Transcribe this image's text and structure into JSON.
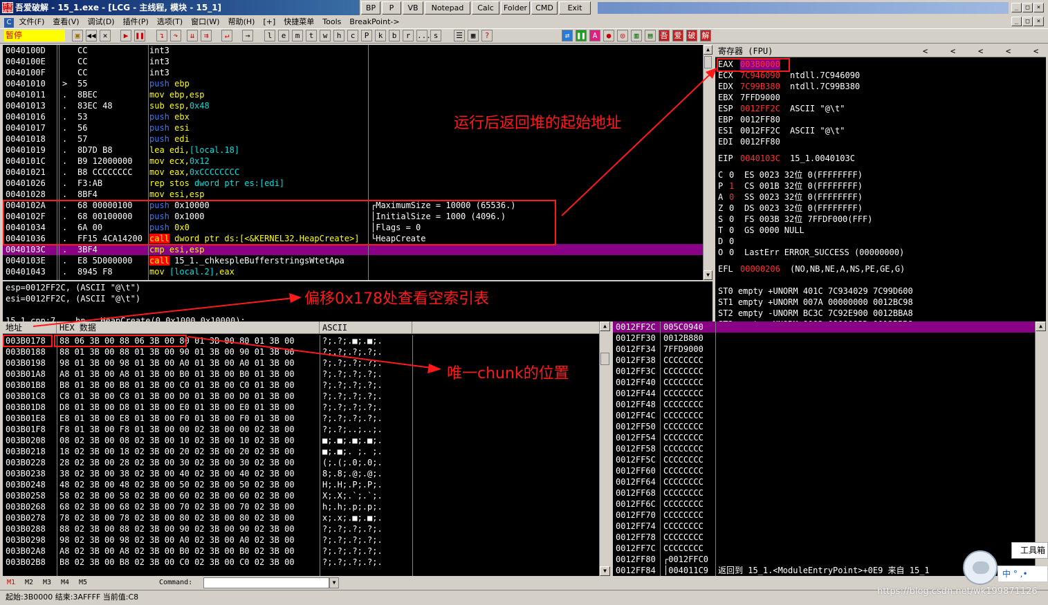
{
  "window": {
    "title": "吾爱破解 - 15_1.exe - [LCG - 主线程, 模块 - 15_1]",
    "logo": "吾爱破解"
  },
  "quick_buttons": [
    "BP",
    "P",
    "VB",
    "Notepad",
    "Calc",
    "Folder",
    "CMD",
    "Exit"
  ],
  "window_buttons": [
    "_",
    "□",
    "×"
  ],
  "child_window_buttons": [
    "_",
    "□",
    "×"
  ],
  "menu": {
    "app_icon": "C",
    "items": [
      "文件(F)",
      "查看(V)",
      "调试(D)",
      "插件(P)",
      "选项(T)",
      "窗口(W)",
      "帮助(H)",
      "[+]",
      "快捷菜单",
      "Tools",
      "BreakPoint->"
    ]
  },
  "toolbar": {
    "status": "暂停",
    "letters": [
      "l",
      "e",
      "m",
      "t",
      "w",
      "h",
      "c",
      "P",
      "k",
      "b",
      "r",
      "...",
      "s"
    ],
    "right_icons": [
      "吾",
      "爱",
      "破",
      "解"
    ]
  },
  "disasm": {
    "rows": [
      {
        "addr": "0040100D",
        "mark": "",
        "hex": "CC",
        "asm": [
          {
            "t": "int3",
            "c": ""
          }
        ],
        "cmt": ""
      },
      {
        "addr": "0040100E",
        "mark": "",
        "hex": "CC",
        "asm": [
          {
            "t": "int3",
            "c": ""
          }
        ],
        "cmt": ""
      },
      {
        "addr": "0040100F",
        "mark": "",
        "hex": "CC",
        "asm": [
          {
            "t": "int3",
            "c": ""
          }
        ],
        "cmt": ""
      },
      {
        "addr": "00401010",
        "mark": ">",
        "hex": "55",
        "asm": [
          {
            "t": "push ",
            "c": "blue"
          },
          {
            "t": "ebp",
            "c": "yel"
          }
        ],
        "cmt": ""
      },
      {
        "addr": "00401011",
        "mark": ".",
        "hex": "8BEC",
        "asm": [
          {
            "t": "mov ",
            "c": "yel"
          },
          {
            "t": "ebp,esp",
            "c": "yel"
          }
        ],
        "cmt": ""
      },
      {
        "addr": "00401013",
        "mark": ".",
        "hex": "83EC 48",
        "asm": [
          {
            "t": "sub ",
            "c": "yel"
          },
          {
            "t": "esp,",
            "c": "yel"
          },
          {
            "t": "0x48",
            "c": "cyan"
          }
        ],
        "cmt": ""
      },
      {
        "addr": "00401016",
        "mark": ".",
        "hex": "53",
        "asm": [
          {
            "t": "push ",
            "c": "blue"
          },
          {
            "t": "ebx",
            "c": "yel"
          }
        ],
        "cmt": ""
      },
      {
        "addr": "00401017",
        "mark": ".",
        "hex": "56",
        "asm": [
          {
            "t": "push ",
            "c": "blue"
          },
          {
            "t": "esi",
            "c": "yel"
          }
        ],
        "cmt": ""
      },
      {
        "addr": "00401018",
        "mark": ".",
        "hex": "57",
        "asm": [
          {
            "t": "push ",
            "c": "blue"
          },
          {
            "t": "edi",
            "c": "yel"
          }
        ],
        "cmt": ""
      },
      {
        "addr": "00401019",
        "mark": ".",
        "hex": "8D7D B8",
        "asm": [
          {
            "t": "lea ",
            "c": "yel"
          },
          {
            "t": "edi,",
            "c": "yel"
          },
          {
            "t": "[local.18]",
            "c": "cyan"
          }
        ],
        "cmt": ""
      },
      {
        "addr": "0040101C",
        "mark": ".",
        "hex": "B9 12000000",
        "asm": [
          {
            "t": "mov ",
            "c": "yel"
          },
          {
            "t": "ecx,",
            "c": "yel"
          },
          {
            "t": "0x12",
            "c": "cyan"
          }
        ],
        "cmt": ""
      },
      {
        "addr": "00401021",
        "mark": ".",
        "hex": "B8 CCCCCCCC",
        "asm": [
          {
            "t": "mov ",
            "c": "yel"
          },
          {
            "t": "eax,",
            "c": "yel"
          },
          {
            "t": "0xCCCCCCCC",
            "c": "cyan"
          }
        ],
        "cmt": ""
      },
      {
        "addr": "00401026",
        "mark": ".",
        "hex": "F3:AB",
        "asm": [
          {
            "t": "rep stos ",
            "c": "yel"
          },
          {
            "t": "dword ptr es:[edi]",
            "c": "cyan"
          }
        ],
        "cmt": ""
      },
      {
        "addr": "00401028",
        "mark": ".",
        "hex": "8BF4",
        "asm": [
          {
            "t": "mov ",
            "c": "yel"
          },
          {
            "t": "esi,esp",
            "c": "yel"
          }
        ],
        "cmt": ""
      },
      {
        "addr": "0040102A",
        "mark": ".",
        "hex": "68 00000100",
        "asm": [
          {
            "t": "push ",
            "c": "blue"
          },
          {
            "t": "0x10000",
            "c": ""
          }
        ],
        "cmt": "┌MaximumSize = 10000 (65536.)"
      },
      {
        "addr": "0040102F",
        "mark": ".",
        "hex": "68 00100000",
        "asm": [
          {
            "t": "push ",
            "c": "blue"
          },
          {
            "t": "0x1000",
            "c": ""
          }
        ],
        "cmt": "│InitialSize = 1000 (4096.)"
      },
      {
        "addr": "00401034",
        "mark": ".",
        "hex": "6A 00",
        "asm": [
          {
            "t": "push ",
            "c": "blue"
          },
          {
            "t": "0x0",
            "c": "yel"
          }
        ],
        "cmt": "│Flags = 0"
      },
      {
        "addr": "00401036",
        "mark": ".",
        "hex": "FF15 4CA14200",
        "asm": [
          {
            "t": "call",
            "c": "call"
          },
          {
            "t": " dword ptr ds:[<&KERNEL32.HeapCreate>]",
            "c": "yel"
          }
        ],
        "cmt": "└HeapCreate"
      },
      {
        "addr": "0040103C",
        "mark": ".",
        "hex": "3BF4",
        "asm": [
          {
            "t": "cmp ",
            "c": "yel"
          },
          {
            "t": "esi,esp",
            "c": "yel"
          }
        ],
        "cmt": "",
        "sel": true
      },
      {
        "addr": "0040103E",
        "mark": ".",
        "hex": "E8 5D000000",
        "asm": [
          {
            "t": "call",
            "c": "call"
          },
          {
            "t": " 15_1._chkesp",
            "c": ""
          },
          {
            "t": "leBufferstringsWtetApa",
            "c": ""
          }
        ],
        "cmt": ""
      },
      {
        "addr": "00401043",
        "mark": ".",
        "hex": "8945 F8",
        "asm": [
          {
            "t": "mov ",
            "c": "yel"
          },
          {
            "t": "[local.2],",
            "c": "cyan"
          },
          {
            "t": "eax",
            "c": "yel"
          }
        ],
        "cmt": ""
      }
    ]
  },
  "info": {
    "line1": "esp=0012FF2C, (ASCII \"@\\t\")",
    "line2": "esi=0012FF2C, (ASCII \"@\\t\")",
    "line3": "15_1.cpp:7    hp = HeapCreate(0,0x1000,0x10000);"
  },
  "dump": {
    "headers": {
      "addr": "地址",
      "hex": "HEX 数据",
      "ascii": "ASCII"
    },
    "rows": [
      {
        "a": "003B0178",
        "h": "88 06 3B 00 88 06 3B 00 80 01 3B 00 80 01 3B 00",
        "s": "?;.?;.■;.■;."
      },
      {
        "a": "003B0188",
        "h": "88 01 3B 00 88 01 3B 00 90 01 3B 00 90 01 3B 00",
        "s": "?;.?;.?;.?;."
      },
      {
        "a": "003B0198",
        "h": "98 01 3B 00 98 01 3B 00 A0 01 3B 00 A0 01 3B 00",
        "s": "?;.?;.?;.?;."
      },
      {
        "a": "003B01A8",
        "h": "A8 01 3B 00 A8 01 3B 00 B0 01 3B 00 B0 01 3B 00",
        "s": "?;.?;.?;.?;."
      },
      {
        "a": "003B01B8",
        "h": "B8 01 3B 00 B8 01 3B 00 C0 01 3B 00 C0 01 3B 00",
        "s": "?;.?;.?;.?;."
      },
      {
        "a": "003B01C8",
        "h": "C8 01 3B 00 C8 01 3B 00 D0 01 3B 00 D0 01 3B 00",
        "s": "?;.?;.?;.?;."
      },
      {
        "a": "003B01D8",
        "h": "D8 01 3B 00 D8 01 3B 00 E0 01 3B 00 E0 01 3B 00",
        "s": "?;.?;.?;.?;."
      },
      {
        "a": "003B01E8",
        "h": "E8 01 3B 00 E8 01 3B 00 F0 01 3B 00 F0 01 3B 00",
        "s": "?;.?;.?;.?;."
      },
      {
        "a": "003B01F8",
        "h": "F8 01 3B 00 F8 01 3B 00 00 02 3B 00 00 02 3B 00",
        "s": "?;.?;..;..;."
      },
      {
        "a": "003B0208",
        "h": "08 02 3B 00 08 02 3B 00 10 02 3B 00 10 02 3B 00",
        "s": "■;.■;.■;.■;."
      },
      {
        "a": "003B0218",
        "h": "18 02 3B 00 18 02 3B 00 20 02 3B 00 20 02 3B 00",
        "s": "■;.■;. ;. ;."
      },
      {
        "a": "003B0228",
        "h": "28 02 3B 00 28 02 3B 00 30 02 3B 00 30 02 3B 00",
        "s": "(;.(;.0;.0;."
      },
      {
        "a": "003B0238",
        "h": "38 02 3B 00 38 02 3B 00 40 02 3B 00 40 02 3B 00",
        "s": "8;.8;.@;.@;."
      },
      {
        "a": "003B0248",
        "h": "48 02 3B 00 48 02 3B 00 50 02 3B 00 50 02 3B 00",
        "s": "H;.H;.P;.P;."
      },
      {
        "a": "003B0258",
        "h": "58 02 3B 00 58 02 3B 00 60 02 3B 00 60 02 3B 00",
        "s": "X;.X;.`;.`;."
      },
      {
        "a": "003B0268",
        "h": "68 02 3B 00 68 02 3B 00 70 02 3B 00 70 02 3B 00",
        "s": "h;.h;.p;.p;."
      },
      {
        "a": "003B0278",
        "h": "78 02 3B 00 78 02 3B 00 80 02 3B 00 80 02 3B 00",
        "s": "x;.x;.■;.■;."
      },
      {
        "a": "003B0288",
        "h": "88 02 3B 00 88 02 3B 00 90 02 3B 00 90 02 3B 00",
        "s": "?;.?;.?;.?;."
      },
      {
        "a": "003B0298",
        "h": "98 02 3B 00 98 02 3B 00 A0 02 3B 00 A0 02 3B 00",
        "s": "?;.?;.?;.?;."
      },
      {
        "a": "003B02A8",
        "h": "A8 02 3B 00 A8 02 3B 00 B0 02 3B 00 B0 02 3B 00",
        "s": "?;.?;.?;.?;."
      },
      {
        "a": "003B02B8",
        "h": "B8 02 3B 00 B8 02 3B 00 C0 02 3B 00 C0 02 3B 00",
        "s": "?;.?;.?;.?;."
      }
    ]
  },
  "registers": {
    "header": "寄存器 (FPU)",
    "nav": [
      "<",
      "<",
      "<",
      "<",
      "<"
    ],
    "gpr": [
      {
        "n": "EAX",
        "v": "003B0000",
        "c": "red",
        "sel": true,
        "x": ""
      },
      {
        "n": "ECX",
        "v": "7C946090",
        "c": "red",
        "x": "ntdll.7C946090"
      },
      {
        "n": "EDX",
        "v": "7C99B380",
        "c": "red",
        "x": "ntdll.7C99B380"
      },
      {
        "n": "EBX",
        "v": "7FFD9000",
        "c": "",
        "x": ""
      },
      {
        "n": "ESP",
        "v": "0012FF2C",
        "c": "red",
        "x": "ASCII \"@\\t\""
      },
      {
        "n": "EBP",
        "v": "0012FF80",
        "c": "",
        "x": ""
      },
      {
        "n": "ESI",
        "v": "0012FF2C",
        "c": "",
        "x": "ASCII \"@\\t\""
      },
      {
        "n": "EDI",
        "v": "0012FF80",
        "c": "",
        "x": ""
      }
    ],
    "eip": {
      "n": "EIP",
      "v": "0040103C",
      "x": "15_1.0040103C"
    },
    "flags": [
      {
        "f": "C",
        "v": "0",
        "vc": "",
        "seg": "ES 0023 32位 0(FFFFFFFF)"
      },
      {
        "f": "P",
        "v": "1",
        "vc": "red",
        "seg": "CS 001B 32位 0(FFFFFFFF)"
      },
      {
        "f": "A",
        "v": "0",
        "vc": "red",
        "seg": "SS 0023 32位 0(FFFFFFFF)"
      },
      {
        "f": "Z",
        "v": "0",
        "vc": "",
        "seg": "DS 0023 32位 0(FFFFFFFF)"
      },
      {
        "f": "S",
        "v": "0",
        "vc": "",
        "seg": "FS 003B 32位 7FFDF000(FFF)"
      },
      {
        "f": "T",
        "v": "0",
        "vc": "",
        "seg": "GS 0000 NULL"
      },
      {
        "f": "D",
        "v": "0",
        "vc": "",
        "seg": ""
      },
      {
        "f": "O",
        "v": "0",
        "vc": "",
        "seg": "LastErr ERROR_SUCCESS (00000000)"
      }
    ],
    "efl": {
      "n": "EFL",
      "v": "00000206",
      "x": "(NO,NB,NE,A,NS,PE,GE,G)"
    },
    "fpu": [
      "ST0 empty +UNORM 401C 7C934029 7C99D600",
      "ST1 empty +UNORM 007A 00000000 0012BC98",
      "ST2 empty -UNORM BC3C 7C92E900 0012BBA8",
      "ST3 empty +UNORM 0002 0000003D 0012BBB8"
    ]
  },
  "stack": {
    "rows": [
      {
        "a": "0012FF2C",
        "v": "005C0940",
        "x": "",
        "sel": true
      },
      {
        "a": "0012FF30",
        "v": "0012B880",
        "x": ""
      },
      {
        "a": "0012FF34",
        "v": "7FFD9000",
        "x": ""
      },
      {
        "a": "0012FF38",
        "v": "CCCCCCCC",
        "x": ""
      },
      {
        "a": "0012FF3C",
        "v": "CCCCCCCC",
        "x": ""
      },
      {
        "a": "0012FF40",
        "v": "CCCCCCCC",
        "x": ""
      },
      {
        "a": "0012FF44",
        "v": "CCCCCCCC",
        "x": ""
      },
      {
        "a": "0012FF48",
        "v": "CCCCCCCC",
        "x": ""
      },
      {
        "a": "0012FF4C",
        "v": "CCCCCCCC",
        "x": ""
      },
      {
        "a": "0012FF50",
        "v": "CCCCCCCC",
        "x": ""
      },
      {
        "a": "0012FF54",
        "v": "CCCCCCCC",
        "x": ""
      },
      {
        "a": "0012FF58",
        "v": "CCCCCCCC",
        "x": ""
      },
      {
        "a": "0012FF5C",
        "v": "CCCCCCCC",
        "x": ""
      },
      {
        "a": "0012FF60",
        "v": "CCCCCCCC",
        "x": ""
      },
      {
        "a": "0012FF64",
        "v": "CCCCCCCC",
        "x": ""
      },
      {
        "a": "0012FF68",
        "v": "CCCCCCCC",
        "x": ""
      },
      {
        "a": "0012FF6C",
        "v": "CCCCCCCC",
        "x": ""
      },
      {
        "a": "0012FF70",
        "v": "CCCCCCCC",
        "x": ""
      },
      {
        "a": "0012FF74",
        "v": "CCCCCCCC",
        "x": ""
      },
      {
        "a": "0012FF78",
        "v": "CCCCCCCC",
        "x": ""
      },
      {
        "a": "0012FF7C",
        "v": "CCCCCCCC",
        "x": ""
      },
      {
        "a": "0012FF80",
        "v": "┌0012FFC0",
        "x": ""
      },
      {
        "a": "0012FF84",
        "v": "│004011C9",
        "x": "返回到 15_1.<ModuleEntryPoint>+0E9 来自 15_1"
      }
    ]
  },
  "annotations": {
    "heap_start": "运行后返回堆的起始地址",
    "offset": "偏移0x178处查看空索引表",
    "chunk": "唯一chunk的位置"
  },
  "command": {
    "m_buttons": [
      "M1",
      "M2",
      "M3",
      "M4",
      "M5"
    ],
    "label": "Command:",
    "value": ""
  },
  "status": {
    "text": "起始:3B0000 结束:3AFFFF 当前值:C8"
  },
  "overlay": {
    "tool_label": "工具箱",
    "ime": "中",
    "ime_extra": "° ,•"
  },
  "watermark": "https://blog.csdn.net/wk199871126",
  "colors": {
    "titlebar": "#0a246a",
    "selection": "#8a0087",
    "annotation": "#ff1a1a",
    "pause_bg": "#ffff00"
  }
}
